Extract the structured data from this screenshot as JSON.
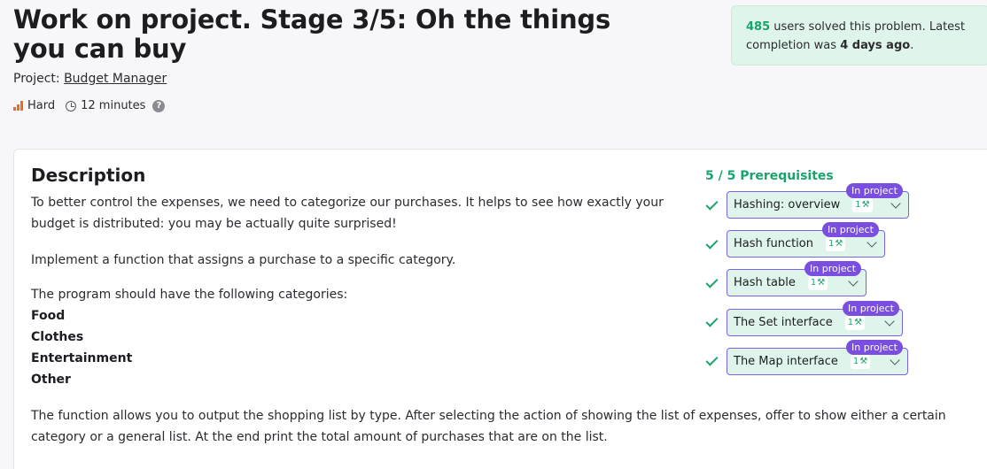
{
  "header": {
    "title": "Work on project. Stage 3/5: Oh the things you can buy",
    "project_prefix": "Project:",
    "project_name": "Budget Manager",
    "difficulty": "Hard",
    "duration": "12 minutes",
    "help": "?"
  },
  "stats": {
    "users_count": "485",
    "users_text": "users solved this problem. Latest completion was",
    "last_completion": "4 days ago",
    "period": "."
  },
  "description": {
    "heading": "Description",
    "para1": "To better control the expenses, we need to categorize our purchases. It helps to see how exactly your budget is distributed: you may be actually quite surprised!",
    "para2": "Implement a function that assigns a purchase to a specific category.",
    "para3": "The program should have the following categories:",
    "categories": [
      "Food",
      "Clothes",
      "Entertainment",
      "Other"
    ],
    "para4": "The function allows you to output the shopping list by type. After selecting the action of showing the list of expenses, offer to show either a certain category or a general list. At the end print the total amount of purchases that are on the list."
  },
  "prerequisites": {
    "heading": "5 / 5 Prerequisites",
    "items": [
      {
        "label": "Hashing: overview",
        "badge": "In project",
        "count": "1"
      },
      {
        "label": "Hash function",
        "badge": "In project",
        "count": "1"
      },
      {
        "label": "Hash table",
        "badge": "In project",
        "count": "1"
      },
      {
        "label": "The Set interface",
        "badge": "In project",
        "count": "1"
      },
      {
        "label": "The Map interface",
        "badge": "In project",
        "count": "1"
      }
    ]
  },
  "colors": {
    "accent_green": "#1aa36b",
    "accent_purple": "#7a4fe0",
    "difficulty_orange": "#ec6b1c"
  },
  "icons": {
    "difficulty": "signal-bars-icon",
    "time": "clock-icon",
    "help": "question-circle-icon",
    "check": "check-icon",
    "expand": "chevron-down-icon",
    "tool": "hammer-icon"
  }
}
